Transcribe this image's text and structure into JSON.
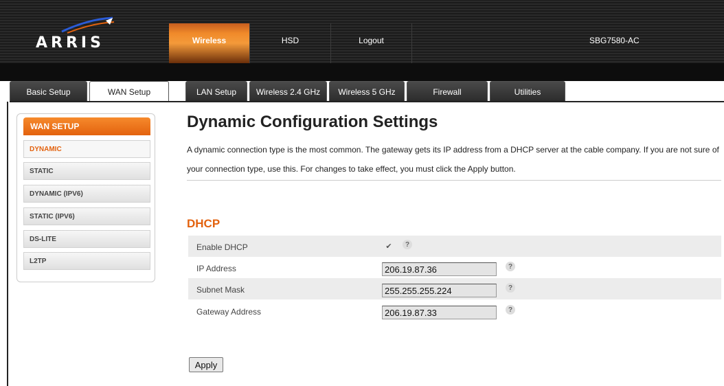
{
  "brand": {
    "logo_text": "ARRIS",
    "accent": "#e3620e"
  },
  "header": {
    "nav": [
      {
        "label": "Wireless",
        "active": true
      },
      {
        "label": "HSD",
        "active": false
      },
      {
        "label": "Logout",
        "active": false
      }
    ],
    "model": "SBG7580-AC"
  },
  "tabs": [
    {
      "label": "Basic Setup",
      "active": false
    },
    {
      "label": "WAN Setup",
      "active": true
    },
    {
      "label": "LAN Setup",
      "active": false
    },
    {
      "label": "Wireless 2.4 GHz",
      "active": false
    },
    {
      "label": "Wireless 5 GHz",
      "active": false
    },
    {
      "label": "Firewall",
      "active": false
    },
    {
      "label": "Utilities",
      "active": false
    }
  ],
  "sidebar": {
    "title": "WAN SETUP",
    "items": [
      {
        "label": "DYNAMIC",
        "active": true
      },
      {
        "label": "STATIC",
        "active": false
      },
      {
        "label": "DYNAMIC (IPV6)",
        "active": false
      },
      {
        "label": "STATIC (IPV6)",
        "active": false
      },
      {
        "label": "DS-LITE",
        "active": false
      },
      {
        "label": "L2TP",
        "active": false
      }
    ]
  },
  "main": {
    "title": "Dynamic Configuration Settings",
    "description": "A dynamic connection type is the most common. The gateway gets its IP address from a DHCP server at the cable company. If you are not sure of your connection type, use this. For changes to take effect, you must click the Apply button.",
    "section_title": "DHCP",
    "fields": {
      "enable_dhcp": {
        "label": "Enable DHCP",
        "checked": true,
        "check_glyph": "✔"
      },
      "ip_address": {
        "label": "IP Address",
        "value": "206.19.87.36"
      },
      "subnet_mask": {
        "label": "Subnet Mask",
        "value": "255.255.255.224"
      },
      "gateway_address": {
        "label": "Gateway Address",
        "value": "206.19.87.33"
      }
    },
    "help_glyph": "?",
    "apply_label": "Apply"
  }
}
